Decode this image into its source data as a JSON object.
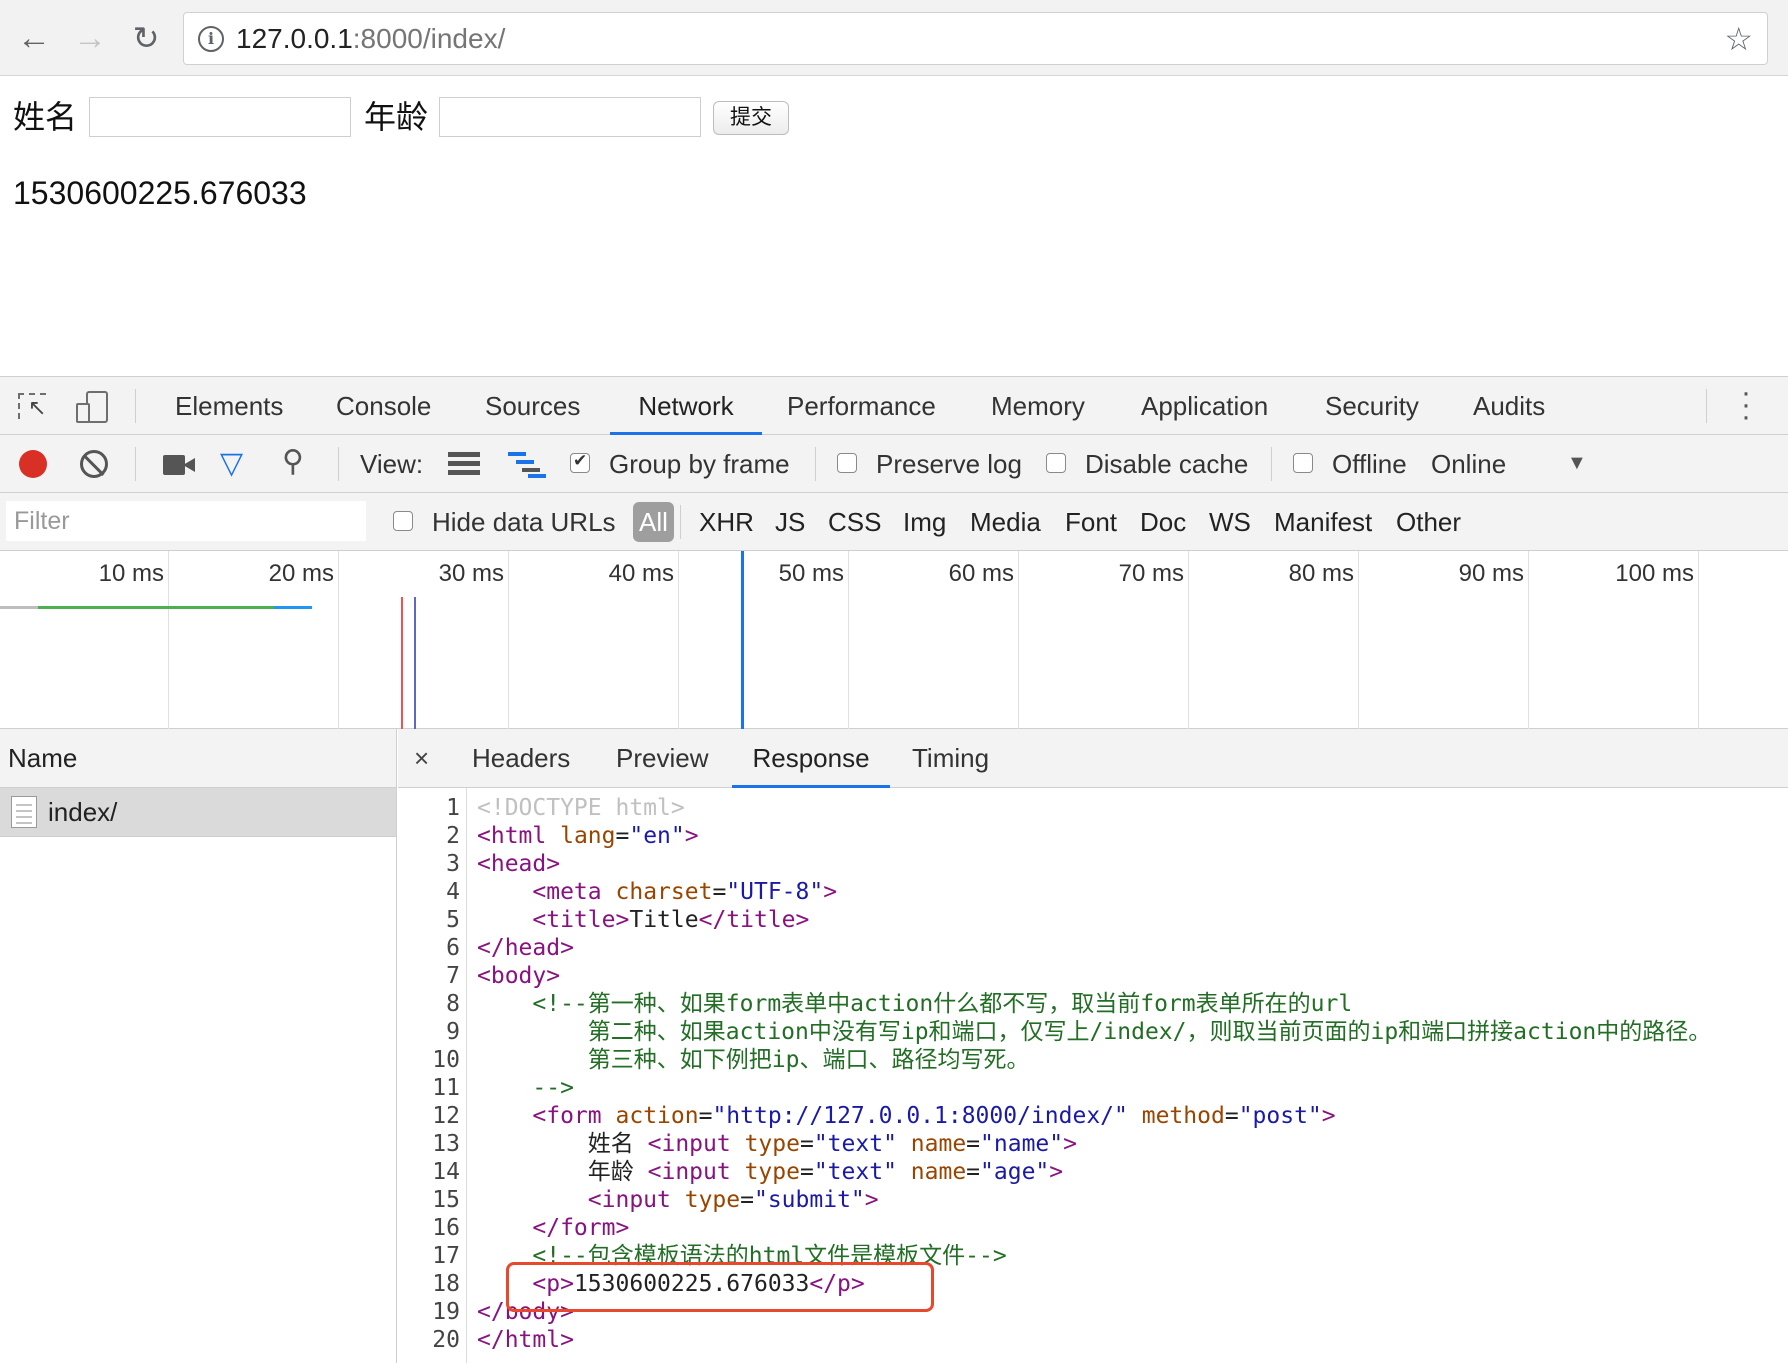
{
  "browser": {
    "url_host": "127.0.0.1",
    "url_path": ":8000/index/"
  },
  "page": {
    "name_label": "姓名",
    "age_label": "年龄",
    "submit_label": "提交",
    "timestamp": "1530600225.676033"
  },
  "devtools": {
    "tabs": [
      "Elements",
      "Console",
      "Sources",
      "Network",
      "Performance",
      "Memory",
      "Application",
      "Security",
      "Audits"
    ],
    "active_tab": "Network",
    "toolbar": {
      "view_label": "View:",
      "group_by_frame": "Group by frame",
      "preserve_log": "Preserve log",
      "disable_cache": "Disable cache",
      "offline": "Offline",
      "throttle": "Online"
    },
    "filter": {
      "placeholder": "Filter",
      "hide_data_urls": "Hide data URLs",
      "types": [
        "All",
        "XHR",
        "JS",
        "CSS",
        "Img",
        "Media",
        "Font",
        "Doc",
        "WS",
        "Manifest",
        "Other"
      ]
    },
    "timeline_ticks": [
      "10 ms",
      "20 ms",
      "30 ms",
      "40 ms",
      "50 ms",
      "60 ms",
      "70 ms",
      "80 ms",
      "90 ms",
      "100 ms"
    ],
    "name_header": "Name",
    "request_name": "index/",
    "detail_tabs": [
      "Headers",
      "Preview",
      "Response",
      "Timing"
    ],
    "close_glyph": "×",
    "code_lines": [
      "<!DOCTYPE html>",
      "<html lang=\"en\">",
      "<head>",
      "    <meta charset=\"UTF-8\">",
      "    <title>Title</title>",
      "</head>",
      "<body>",
      "    <!--第一种、如果form表单中action什么都不写，取当前form表单所在的url",
      "        第二种、如果action中没有写ip和端口，仅写上/index/，则取当前页面的ip和端口拼接action中的路径。",
      "        第三种、如下例把ip、端口、路径均写死。",
      "    -->",
      "    <form action=\"http://127.0.0.1:8000/index/\" method=\"post\">",
      "        姓名 <input type=\"text\" name=\"name\">",
      "        年龄 <input type=\"text\" name=\"age\">",
      "        <input type=\"submit\">",
      "    </form>",
      "    <!--包含模板语法的html文件是模板文件-->",
      "    <p>1530600225.676033</p>",
      "</body>",
      "</html>"
    ]
  },
  "colors": {
    "accent": "#1a73e8",
    "record": "#d93025",
    "highlight": "#e8482c"
  }
}
